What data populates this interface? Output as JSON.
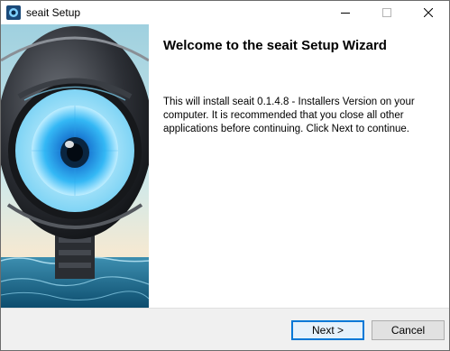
{
  "window": {
    "title": "seait Setup"
  },
  "banner": {
    "icon": "robotic-eye-illustration"
  },
  "content": {
    "heading": "Welcome to the seait Setup Wizard",
    "body": "This will install seait 0.1.4.8 - Installers Version on your computer. It is recommended that you close all other applications before continuing. Click Next to continue."
  },
  "buttons": {
    "next": "Next >",
    "cancel": "Cancel"
  },
  "colors": {
    "accent": "#0078d7",
    "eye_blue": "#1e9bf0",
    "footer_bg": "#f0f0f0"
  }
}
